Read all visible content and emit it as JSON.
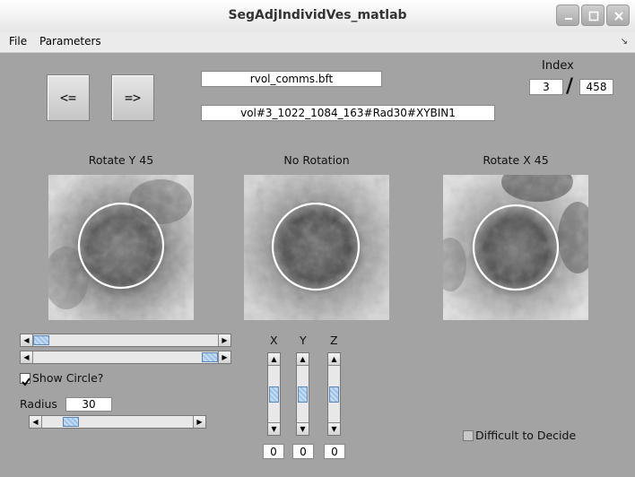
{
  "window": {
    "title": "SegAdjIndividVes_matlab"
  },
  "menu": {
    "file": "File",
    "parameters": "Parameters"
  },
  "nav": {
    "prev_label": "<=",
    "next_label": "=>"
  },
  "files": {
    "filename": "rvol_comms.bft",
    "vesicle_id": "vol#3_1022_1084_163#Rad30#XYBIN1"
  },
  "index": {
    "label": "Index",
    "current": "3",
    "separator": "/",
    "total": "458"
  },
  "views": [
    {
      "label": "Rotate Y 45"
    },
    {
      "label": "No Rotation"
    },
    {
      "label": "Rotate X 45"
    }
  ],
  "controls": {
    "show_circle_label": "Show Circle?",
    "show_circle_checked": true,
    "radius_label": "Radius",
    "radius_value": "30",
    "difficult_label": "Difficult to Decide",
    "difficult_checked": false
  },
  "axes": {
    "x_label": "X",
    "y_label": "Y",
    "z_label": "Z",
    "x_value": "0",
    "y_value": "0",
    "z_value": "0"
  },
  "colors": {
    "background": "#a3a3a3",
    "slider_thumb": "#9fc3e8"
  }
}
